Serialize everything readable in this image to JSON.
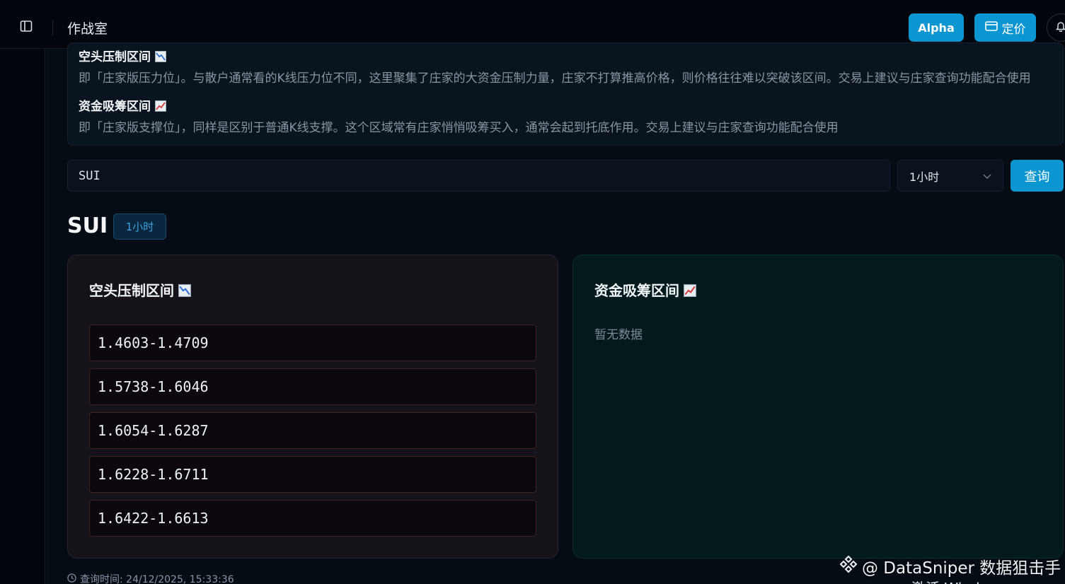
{
  "header": {
    "title": "作战室",
    "alpha_label": "Alpha",
    "pricing_label": "定价"
  },
  "info": {
    "short_title": "空头压制区间",
    "short_desc": "即「庄家版压力位」。与散户通常看的K线压力位不同，这里聚集了庄家的大资金压制力量，庄家不打算推高价格，则价格往往难以突破该区间。交易上建议与庄家查询功能配合使用",
    "long_title": "资金吸筹区间",
    "long_desc": "即「庄家版支撑位」，同样是区别于普通K线支撑。这个区域常有庄家悄悄吸筹买入，通常会起到托底作用。交易上建议与庄家查询功能配合使用"
  },
  "query": {
    "symbol_value": "SUI",
    "interval_value": "1小时",
    "submit_label": "查询"
  },
  "result": {
    "symbol": "SUI",
    "interval_badge": "1小时",
    "short_zone": {
      "title": "空头压制区间",
      "icon": "chart-decreasing-icon",
      "ranges": [
        "1.4603-1.4709",
        "1.5738-1.6046",
        "1.6054-1.6287",
        "1.6228-1.6711",
        "1.6422-1.6613"
      ]
    },
    "long_zone": {
      "title": "资金吸筹区间",
      "icon": "chart-increasing-icon",
      "empty_text": "暂无数据"
    },
    "query_time": "查询时间: 24/12/2025, 15:33:36"
  },
  "watermark": {
    "text": "@ DataSniper 数据狙击手",
    "sub": "激活 Windows"
  },
  "colors": {
    "accent": "#0b95d1",
    "background": "#060c14",
    "short_card": "#15121a",
    "long_card": "#021a1b"
  }
}
